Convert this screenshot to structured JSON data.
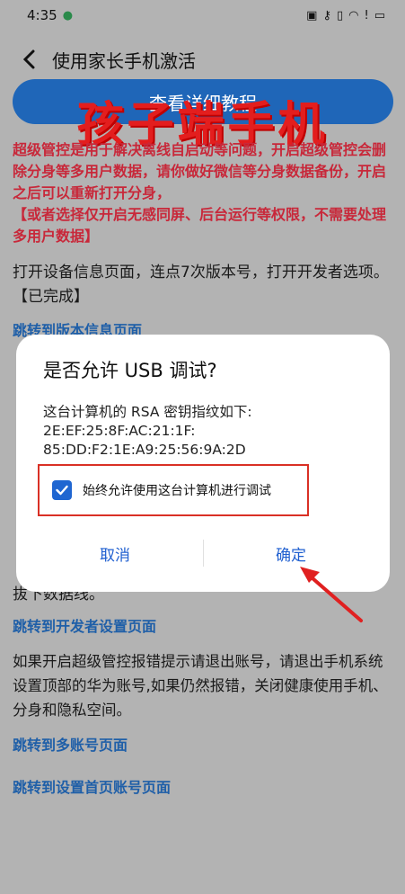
{
  "status_bar": {
    "time": "4:35",
    "icons": [
      "nfc-icon",
      "key-icon",
      "vibrate-icon",
      "wifi-icon",
      "alert-icon",
      "battery-icon"
    ]
  },
  "app_bar": {
    "title": "使用家长手机激活"
  },
  "tutorial_button": {
    "label": "查看详细教程"
  },
  "overlay_title": "孩子端手机",
  "warning": {
    "line1": "超级管控是用于解决离线自启动等问题，开启超级管控会删除分身等多用户数据，请你做好微信等分身数据备份，开启之后可以重新打开分身，",
    "line2": "【或者选择仅开启无感同屏、后台运行等权限，不需要处理多用户数据】"
  },
  "step1": "打开设备信息页面，连点7次版本号，打开开发者选项。【已完成】",
  "link_version": "跳转到版本信息页面",
  "step_tail": "拔下数据线。",
  "link_developer": "跳转到开发者设置页面",
  "step2": "如果开启超级管控报错提示请退出账号，请退出手机系统设置顶部的华为账号,如果仍然报错，关闭健康使用手机、分身和隐私空间。",
  "link_multi_account": "跳转到多账号页面",
  "link_settings_account": "跳转到设置首页账号页面",
  "dialog": {
    "title": "是否允许 USB 调试?",
    "message_label": "这台计算机的 RSA 密钥指纹如下:",
    "fingerprint_line1": "2E:EF:25:8F:AC:21:1F:",
    "fingerprint_line2": "85:DD:F2:1E:A9:25:56:9A:2D",
    "checkbox_label": "始终允许使用这台计算机进行调试",
    "checkbox_checked": true,
    "cancel_label": "取消",
    "ok_label": "确定"
  },
  "colors": {
    "accent": "#1f66d1",
    "warning": "#c8283a",
    "annotation": "#d93025"
  }
}
